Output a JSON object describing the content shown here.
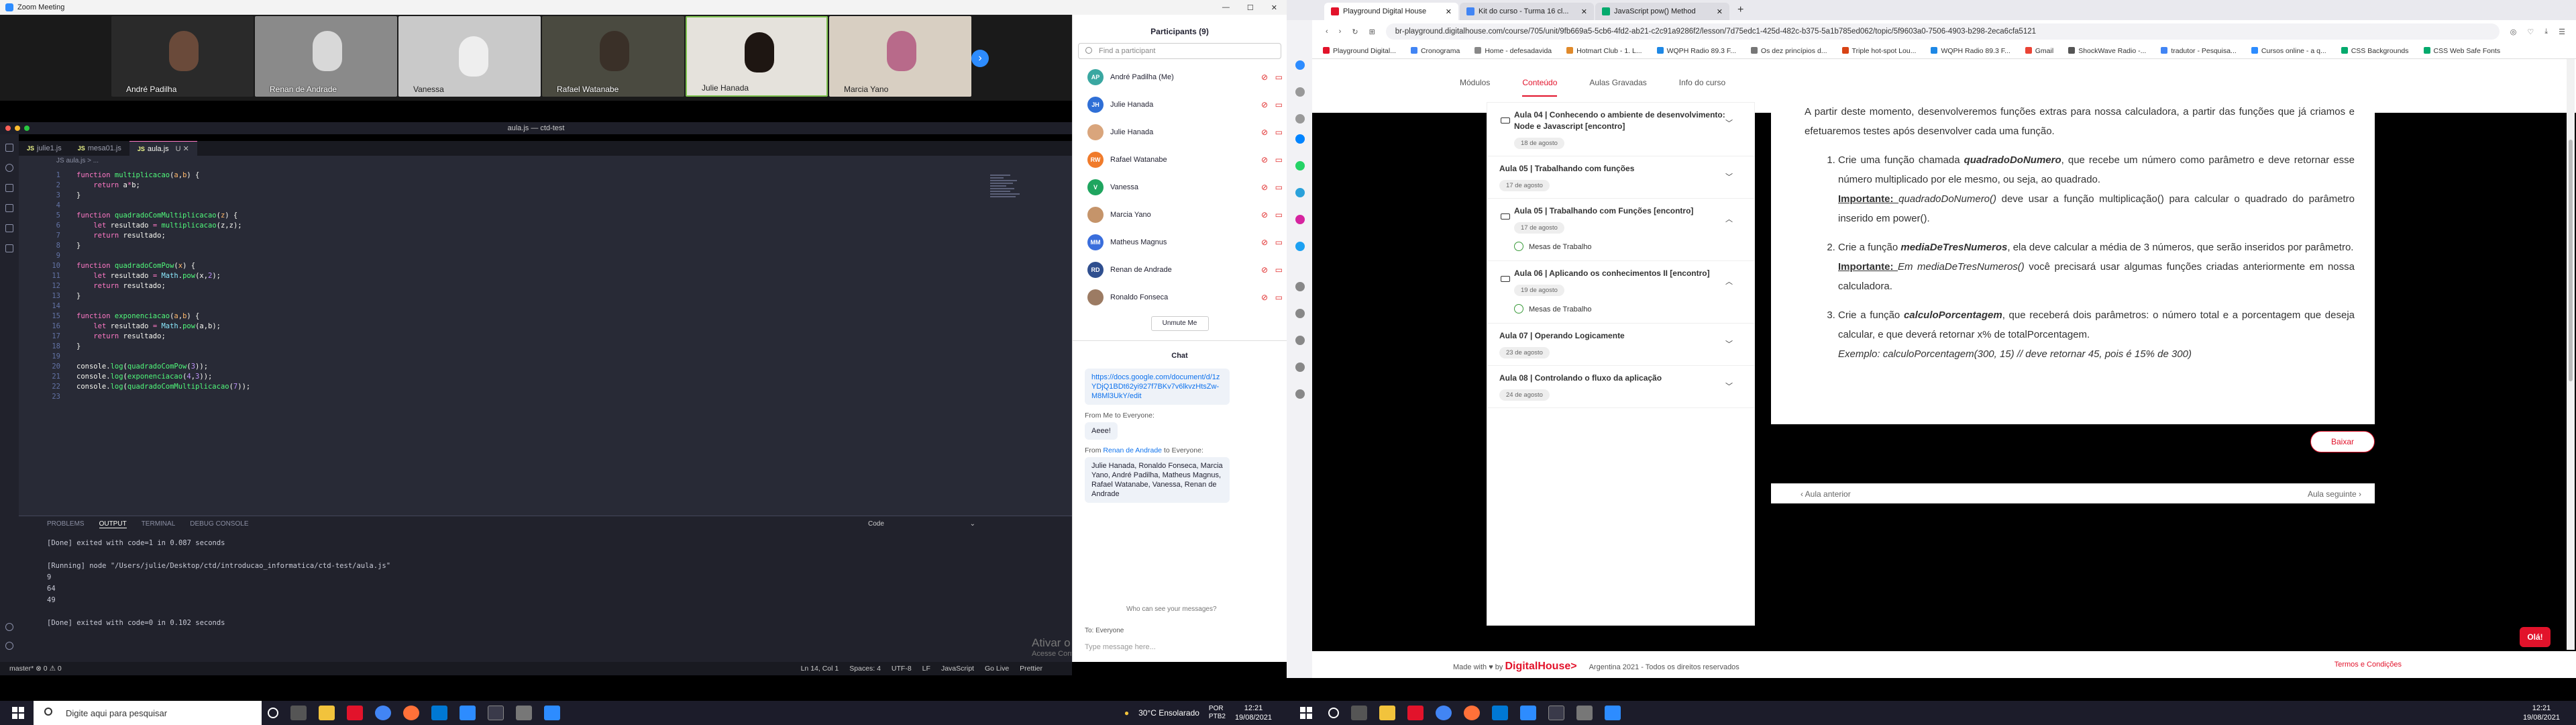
{
  "zoom": {
    "window_title": "Zoom Meeting",
    "gallery": [
      "André Padilha",
      "Renan de Andrade",
      "Vanessa",
      "Rafael Watanabe",
      "Julie Hanada",
      "Marcia Yano"
    ],
    "participants_title": "Participants (9)",
    "search_placeholder": "Find a participant",
    "participants": [
      {
        "initials": "AP",
        "name": "André Padilha (Me)",
        "color": "#3aa7a1"
      },
      {
        "initials": "JH",
        "name": "Julie Hanada",
        "color": "#2f6fd6"
      },
      {
        "initials": "",
        "name": "Julie Hanada",
        "color": "#d9a57c"
      },
      {
        "initials": "RW",
        "name": "Rafael Watanabe",
        "color": "#f07b2b"
      },
      {
        "initials": "V",
        "name": "Vanessa",
        "color": "#1fa55f"
      },
      {
        "initials": "",
        "name": "Marcia Yano",
        "color": "#c5946a"
      },
      {
        "initials": "MM",
        "name": "Matheus Magnus",
        "color": "#3a6edc"
      },
      {
        "initials": "RD",
        "name": "Renan de Andrade",
        "color": "#2f4f8f"
      },
      {
        "initials": "",
        "name": "Ronaldo Fonseca",
        "color": "#9c7b63"
      }
    ],
    "unmute": "Unmute Me",
    "chat_title": "Chat",
    "link": "https://docs.google.com/document/d/1zYDjQ1BDt62yi927f7BKv7v6lkvzHtsZw-M8Ml3UkY/edit",
    "from_me": "From Me to Everyone:",
    "msg1": "Aeee!",
    "from_renan_pre": "From ",
    "from_renan_name": "Renan de Andrade",
    "from_renan_post": " to Everyone:",
    "msg2": "Julie Hanada, Ronaldo Fonseca, Marcia Yano, André Padilha, Matheus Magnus, Rafael Watanabe, Vanessa, Renan de Andrade",
    "who_can_see": "Who can see your messages?",
    "to": "To: Everyone",
    "type_placeholder": "Type message here..."
  },
  "vscode": {
    "title": "aula.js — ctd-test",
    "tabs": [
      "julie1.js",
      "mesa01.js",
      "aula.js"
    ],
    "breadcrumb": "JS aula.js > ...",
    "line_numbers": "1\n2\n3\n4\n5\n6\n7\n8\n9\n10\n11\n12\n13\n14\n15\n16\n17\n18\n19\n20\n21\n22\n23",
    "panel_tabs": [
      "PROBLEMS",
      "OUTPUT",
      "TERMINAL",
      "DEBUG CONSOLE"
    ],
    "panel_select": "Code",
    "output": "[Done] exited with code=1 in 0.087 seconds\n\n[Running] node \"/Users/julie/Desktop/ctd/introducao_informatica/ctd-test/aula.js\"\n9\n64\n49\n\n[Done] exited with code=0 in 0.102 seconds",
    "status_left": "master*   ⊗ 0 ⚠ 0",
    "status_right": [
      "Ln 14, Col 1",
      "Spaces: 4",
      "UTF-8",
      "LF",
      "JavaScript",
      "Go Live",
      "Prettier"
    ],
    "activate_title": "Ativar o Windows",
    "activate_sub": "Acesse Configurações para ativar o Windows."
  },
  "browser": {
    "tabs": [
      "Playground Digital House",
      "Kit do curso - Turma 16 cl...",
      "JavaScript pow() Method"
    ],
    "url": "br-playground.digitalhouse.com/course/705/unit/9fb669a5-5cb6-4fd2-ab21-c2c91a9286f2/lesson/7d75edc1-425d-482c-b375-5a1b785ed062/topic/5f9603a0-7506-4903-b298-2eca6cfa5121",
    "bookmarks": [
      "Playground Digital...",
      "Cronograma",
      "Home - defesadavida",
      "Hotmart Club - 1. L...",
      "WQPH Radio 89.3 F...",
      "Os dez princípios d...",
      "Triple hot-spot Lou...",
      "WQPH Radio 89.3 F...",
      "Gmail",
      "ShockWave Radio -...",
      "tradutor - Pesquisa...",
      "Cursos online - a q...",
      "CSS Backgrounds",
      "CSS Web Safe Fonts"
    ],
    "site_nav": [
      "Módulos",
      "Conteúdo",
      "Aulas Gravadas",
      "Info do curso"
    ],
    "lessons": [
      {
        "title": "Aula 04 | Conhecendo o ambiente de desenvolvimento: Node e Javascript [encontro]",
        "date": "18 de agosto",
        "cam": true,
        "open": false
      },
      {
        "title": "Aula 05 | Trabalhando com funções",
        "date": "17 de agosto",
        "cam": false,
        "open": false
      },
      {
        "title": "Aula 05 | Trabalhando com Funções [encontro]",
        "date": "17 de agosto",
        "cam": true,
        "open": true,
        "sub": "Mesas de Trabalho"
      },
      {
        "title": "Aula 06 | Aplicando os conhecimentos II [encontro]",
        "date": "19 de agosto",
        "cam": true,
        "open": true,
        "sub": "Mesas de Trabalho"
      },
      {
        "title": "Aula 07 | Operando Logicamente",
        "date": "23 de agosto",
        "cam": false,
        "open": false
      },
      {
        "title": "Aula 08 | Controlando o fluxo da aplicação",
        "date": "24 de agosto",
        "cam": false,
        "open": false
      }
    ],
    "intro": "A partir deste momento, desenvolveremos funções extras para nossa calculadora, a partir das funções que já criamos e efetuaremos testes após desenvolver cada uma função.",
    "items": [
      {
        "a": "Crie uma função chamada ",
        "b": "quadradoDoNumero",
        "c": ", que recebe um número como parâmetro e deve retornar esse número multiplicado por ele mesmo, ou seja, ao quadrado.",
        "imp": "Importante: ",
        "note": "quadradoDoNumero()",
        "rest": " deve usar a função multiplicação() para calcular o quadrado do parâmetro inserido em power()."
      },
      {
        "a": "Crie a função ",
        "b": "mediaDeTresNumeros",
        "c": ", ela deve calcular a média de 3 números, que serão inseridos por parâmetro.",
        "imp": "Importante: ",
        "note": "Em mediaDeTresNumeros()",
        "rest": " você precisará usar algumas funções criadas anteriormente em nossa calculadora."
      },
      {
        "a": "Crie a função ",
        "b": "calculoPorcentagem",
        "c": ", que receberá dois parâmetros: o número total e a porcentagem que deseja calcular, e que deverá retornar x% de totalPorcentagem.",
        "imp": "",
        "note": "Exemplo: calculoPorcentagem(300, 15) // deve retornar 45, pois é 15% de 300)",
        "rest": ""
      }
    ],
    "sair": "Baixar",
    "prev": "‹  Aula anterior",
    "next": "Aula seguinte  ›",
    "footer_made": "Made with ♥ by ",
    "footer_brand": "DigitalHouse>",
    "footer_year": "Argentina 2021 - Todos os direitos reservados",
    "footer_terms": "Termos e Condições",
    "ola": "Olá!"
  },
  "taskbar": {
    "search": "Digite aqui para pesquisar",
    "weather": "30°C  Ensolarado",
    "lang": "POR\nPTB2",
    "time": "12:21",
    "date": "19/08/2021"
  }
}
